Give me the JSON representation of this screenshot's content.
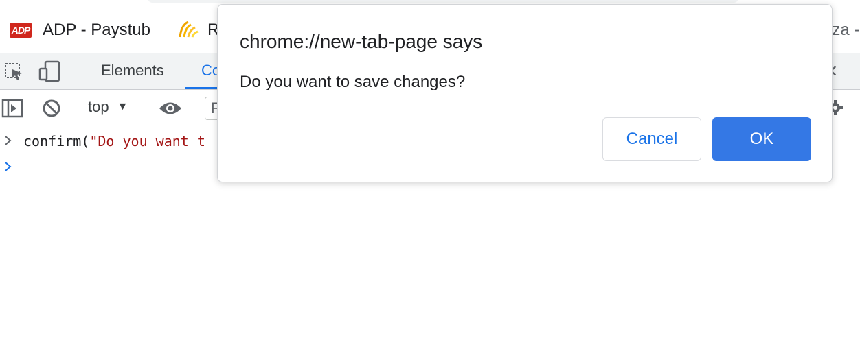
{
  "bookmarks": {
    "items": [
      {
        "label": "ADP - Paystub",
        "logo_text": "ADP"
      },
      {
        "label": "R"
      },
      {
        "label": "nza -"
      }
    ]
  },
  "devtools": {
    "tabs": [
      {
        "label": "Elements"
      },
      {
        "label": "Co"
      }
    ],
    "close_glyph": "✕"
  },
  "console": {
    "context_label": "top",
    "filter_partial": "F",
    "entries": [
      {
        "fn_text": "confirm(",
        "str_text": "\"Do you want t"
      }
    ]
  },
  "dialog": {
    "title": "chrome://new-tab-page says",
    "message": "Do you want to save changes?",
    "cancel_label": "Cancel",
    "ok_label": "OK"
  },
  "colors": {
    "accent": "#1a73e8",
    "ok_button": "#3478e5",
    "string_literal": "#a31515"
  }
}
